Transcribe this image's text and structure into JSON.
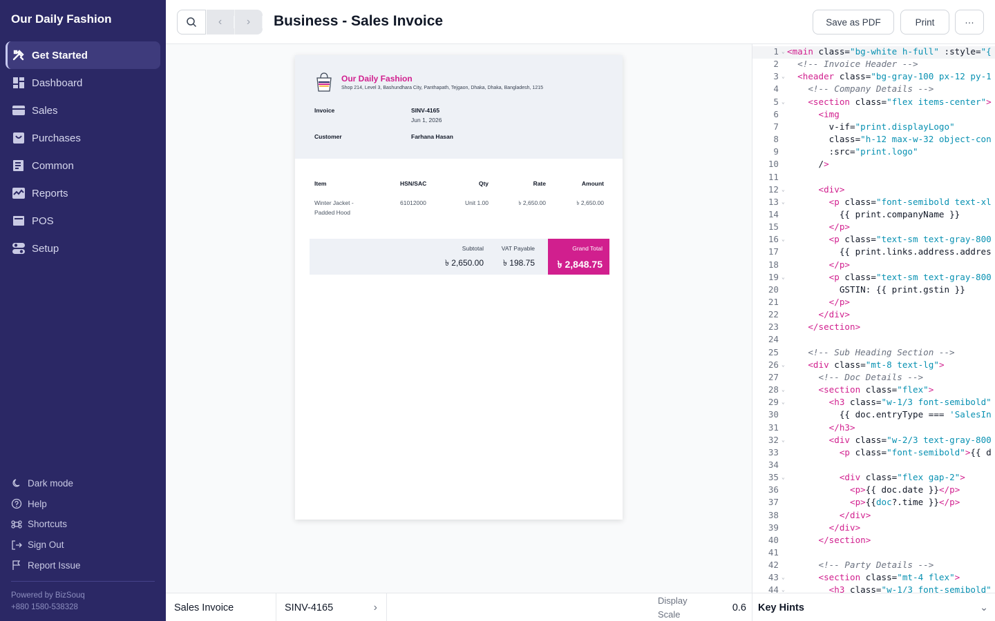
{
  "sidebar": {
    "brand": "Our Daily Fashion",
    "items": [
      {
        "label": "Get Started",
        "icon": "tools-icon"
      },
      {
        "label": "Dashboard",
        "icon": "dashboard-icon"
      },
      {
        "label": "Sales",
        "icon": "sales-icon"
      },
      {
        "label": "Purchases",
        "icon": "purchases-icon"
      },
      {
        "label": "Common",
        "icon": "common-icon"
      },
      {
        "label": "Reports",
        "icon": "reports-icon"
      },
      {
        "label": "POS",
        "icon": "pos-icon"
      },
      {
        "label": "Setup",
        "icon": "setup-icon"
      }
    ],
    "bottom": [
      {
        "label": "Dark mode",
        "icon": "moon-icon"
      },
      {
        "label": "Help",
        "icon": "help-icon"
      },
      {
        "label": "Shortcuts",
        "icon": "command-icon"
      },
      {
        "label": "Sign Out",
        "icon": "sign-out-icon"
      },
      {
        "label": "Report Issue",
        "icon": "flag-icon"
      }
    ],
    "powered_by": "Powered by BizSouq",
    "phone": "+880 1580-538328"
  },
  "header": {
    "title": "Business - Sales Invoice",
    "save_pdf": "Save as PDF",
    "print": "Print",
    "more": "···"
  },
  "invoice": {
    "company_name": "Our Daily Fashion",
    "company_address": "Shop 214, Level 3, Bashundhara City, Panthapath, Tejgaon, Dhaka, Dhaka, Bangladesh, 1215",
    "invoice_label": "Invoice",
    "invoice_number": "SINV-4165",
    "invoice_date": "Jun 1, 2026",
    "customer_label": "Customer",
    "customer_name": "Farhana Hasan",
    "columns": {
      "item": "Item",
      "hsn": "HSN/SAC",
      "qty": "Qty",
      "rate": "Rate",
      "amount": "Amount"
    },
    "row": {
      "item_line1": "Winter Jacket -",
      "item_line2": "Padded Hood",
      "hsn": "61012000",
      "qty": "Unit 1.00",
      "rate": "৳ 2,650.00",
      "amount": "৳ 2,650.00"
    },
    "subtotal_label": "Subtotal",
    "subtotal": "৳ 2,650.00",
    "vat_label": "VAT Payable",
    "vat": "৳ 198.75",
    "grand_label": "Grand Total",
    "grand": "৳ 2,848.75"
  },
  "code": {
    "lines": [
      "<main class=\"bg-white h-full\" :style=\"{",
      "  <!-- Invoice Header -->",
      "  <header class=\"bg-gray-100 px-12 py-1",
      "    <!-- Company Details -->",
      "    <section class=\"flex items-center\">",
      "      <img",
      "        v-if=\"print.displayLogo\"",
      "        class=\"h-12 max-w-32 object-con",
      "        :src=\"print.logo\"",
      "      />",
      "",
      "      <div>",
      "        <p class=\"font-semibold text-xl",
      "          {{ print.companyName }}",
      "        </p>",
      "        <p class=\"text-sm text-gray-800",
      "          {{ print.links.address.addres",
      "        </p>",
      "        <p class=\"text-sm text-gray-800",
      "          GSTIN: {{ print.gstin }}",
      "        </p>",
      "      </div>",
      "    </section>",
      "",
      "    <!-- Sub Heading Section -->",
      "    <div class=\"mt-8 text-lg\">",
      "      <!-- Doc Details -->",
      "      <section class=\"flex\">",
      "        <h3 class=\"w-1/3 font-semibold\"",
      "          {{ doc.entryType === 'SalesIn",
      "        </h3>",
      "        <div class=\"w-2/3 text-gray-800",
      "          <p class=\"font-semibold\">{{ d",
      "",
      "          <div class=\"flex gap-2\">",
      "            <p>{{ doc.date }}</p>",
      "            <p>{{doc?.time }}</p>",
      "          </div>",
      "        </div>",
      "      </section>",
      "",
      "      <!-- Party Details -->",
      "      <section class=\"mt-4 flex\">",
      "        <h3 class=\"w-1/3 font-semibold\""
    ],
    "folds": [
      1,
      3,
      5,
      12,
      13,
      16,
      19,
      26,
      28,
      29,
      32,
      35,
      43,
      44
    ]
  },
  "footer": {
    "doc_type": "Sales Invoice",
    "doc_number": "SINV-4165",
    "display_scale_label": "Display Scale",
    "display_scale_value": "0.6",
    "key_hints": "Key Hints"
  }
}
